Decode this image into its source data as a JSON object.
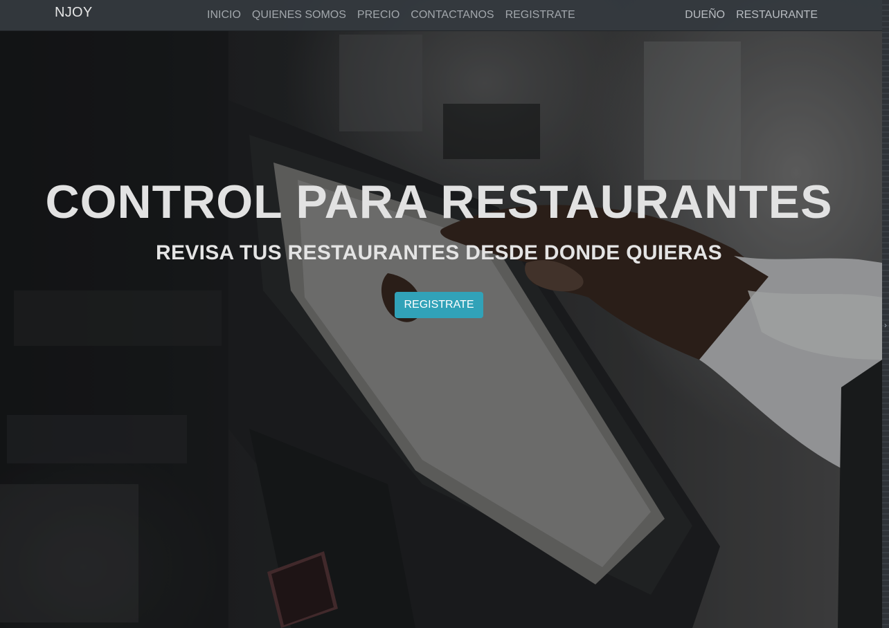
{
  "navbar": {
    "brand": "NJOY",
    "links": [
      "INICIO",
      "QUIENES SOMOS",
      "PRECIO",
      "CONTACTANOS",
      "REGISTRATE"
    ],
    "right_links": [
      "DUEÑO",
      "RESTAURANTE"
    ]
  },
  "hero": {
    "title": "CONTROL PARA RESTAURANTES",
    "subtitle": "REVISA TUS RESTAURANTES DESDE DONDE QUIERAS",
    "cta_label": "REGISTRATE",
    "image_icon": "pos-terminal-photo"
  },
  "colors": {
    "accent": "#31a2b8",
    "navbar_bg": "#34393f",
    "text_light": "#e2e2e2"
  }
}
